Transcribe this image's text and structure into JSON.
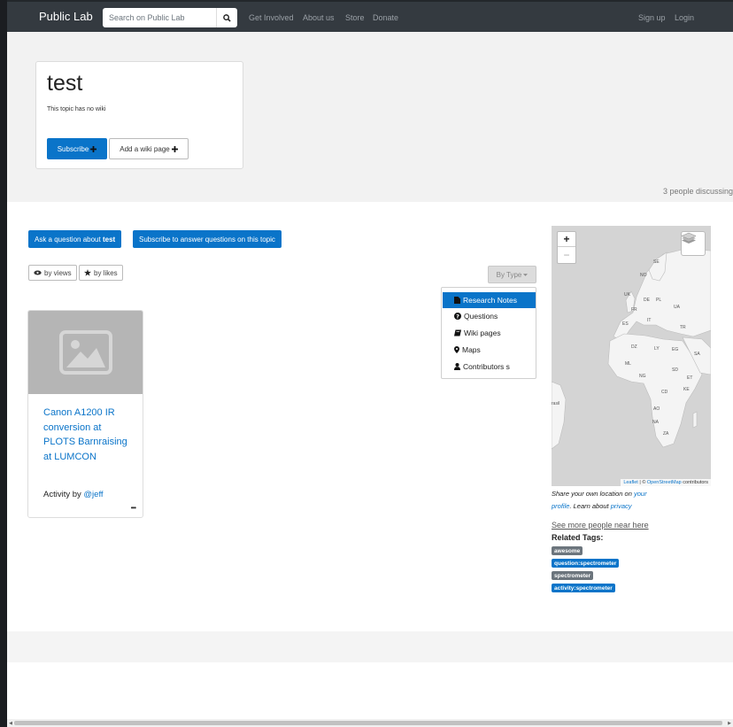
{
  "navbar": {
    "brand": "Public Lab",
    "search_placeholder": "Search on Public Lab",
    "links": [
      "Get Involved",
      "About us",
      "Store",
      "Donate"
    ],
    "sign_up": "Sign up",
    "login": "Login"
  },
  "topic": {
    "title": "test",
    "subtitle": "This topic has no wiki",
    "subscribe_label": "Subscribe",
    "add_wiki_label": "Add a wiki page",
    "discussing": "3 people discussing"
  },
  "actions": {
    "ask_prefix": "Ask a question about ",
    "ask_topic": "test",
    "subscribe_answer": "Subscribe to answer questions on this topic"
  },
  "sort": {
    "by_views": "by views",
    "by_likes": "by likes"
  },
  "type_filter": {
    "label": "By Type",
    "items": [
      "Research Notes",
      "Questions",
      "Wiki pages",
      "Maps",
      "Contributors s"
    ],
    "active_index": 0
  },
  "note": {
    "title": "Canon A1200 IR conversion at PLOTS Barnraising at LUMCON",
    "activity_prefix": "Activity by ",
    "author": "@jeff",
    "more": "•••"
  },
  "map": {
    "zoom_in": "+",
    "zoom_out": "−",
    "labels": [
      "SE",
      "NO",
      "UK",
      "DE",
      "PL",
      "FR",
      "UA",
      "IT",
      "ES",
      "TR",
      "DZ",
      "LY",
      "EG",
      "SA",
      "ML",
      "NG",
      "SD",
      "ET",
      "CD",
      "KE",
      "AO",
      "NA",
      "ZA",
      "rasil"
    ],
    "attribution_leaflet": "Leaflet",
    "attribution_sep": " | © ",
    "attribution_osm": "OpenStreetMap",
    "attribution_suffix": " contributors"
  },
  "sidebar": {
    "share_prefix": "Share your own location on ",
    "share_link": "your profile",
    "share_middle": ". Learn about ",
    "privacy_link": "privacy",
    "see_more": "See more people near here",
    "related_heading": "Related Tags:",
    "tags": [
      {
        "label": "awesome",
        "color": "#6c757d"
      },
      {
        "label": "question:spectrometer",
        "color": "#0a74c9"
      },
      {
        "label": "spectrometer",
        "color": "#6c757d"
      },
      {
        "label": "activity:spectrometer",
        "color": "#0a74c9"
      }
    ]
  },
  "colors": {
    "primary": "#0a74c9",
    "navbar": "#343a40",
    "tag_grey": "#6c757d"
  }
}
